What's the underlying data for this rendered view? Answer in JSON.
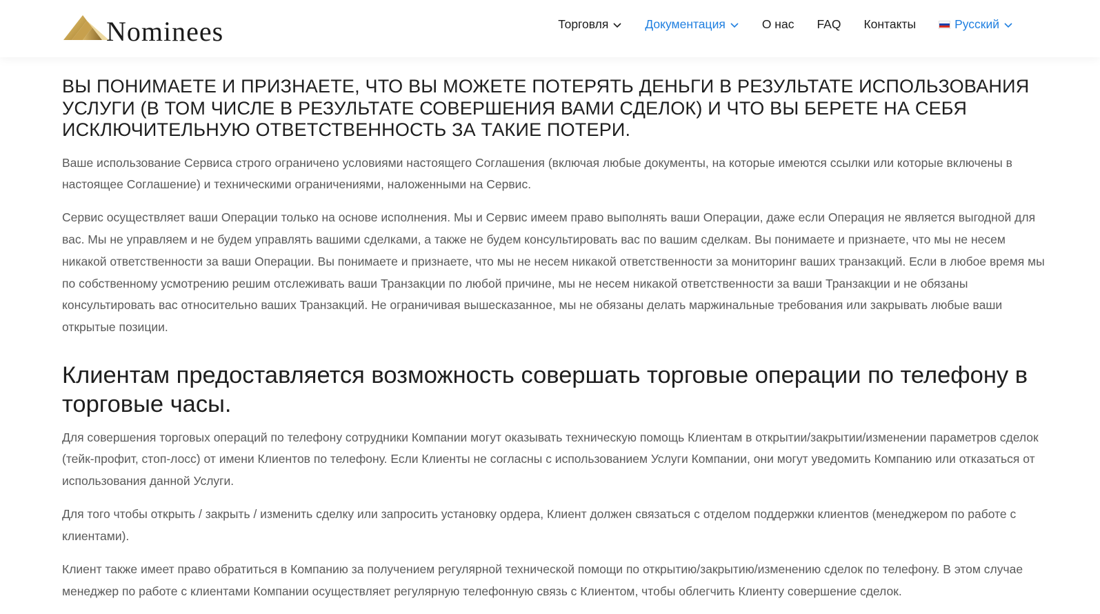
{
  "header": {
    "logo_text": "Nominees",
    "nav": [
      {
        "label": "Торговля",
        "has_dropdown": true,
        "active": false
      },
      {
        "label": "Документация",
        "has_dropdown": true,
        "active": true
      },
      {
        "label": "О нас",
        "has_dropdown": false,
        "active": false
      },
      {
        "label": "FAQ",
        "has_dropdown": false,
        "active": false
      },
      {
        "label": "Контакты",
        "has_dropdown": false,
        "active": false
      }
    ],
    "language": {
      "label": "Русский",
      "flag_icon": "russia-flag-icon"
    }
  },
  "colors": {
    "accent": "#1f7fe0",
    "text_dark": "#1e1e1e",
    "text_body": "#5a5a5a",
    "logo_gold": "#c9a24a"
  },
  "content": {
    "warning_heading": "ВЫ ПОНИМАЕТЕ И ПРИЗНАЕТЕ, ЧТО ВЫ МОЖЕТЕ ПОТЕРЯТЬ ДЕНЬГИ В РЕЗУЛЬТАТЕ ИСПОЛЬЗОВАНИЯ УСЛУГИ (В ТОМ ЧИСЛЕ В РЕЗУЛЬТАТЕ СОВЕРШЕНИЯ ВАМИ СДЕЛОК) И ЧТО ВЫ БЕРЕТЕ НА СЕБЯ ИСКЛЮЧИТЕЛЬНУЮ ОТВЕТСТВЕННОСТЬ ЗА ТАКИЕ ПОТЕРИ.",
    "para1": "Ваше использование Сервиса строго ограничено условиями настоящего Соглашения (включая любые документы, на которые имеются ссылки или которые включены в настоящее Соглашение) и техническими ограничениями, наложенными на Сервис.",
    "para2": "Сервис осуществляет ваши Операции только на основе исполнения. Мы и Сервис имеем право выполнять ваши Операции, даже если Операция не является выгодной для вас. Мы не управляем и не будем управлять вашими сделками, а также не будем консультировать вас по вашим сделкам. Вы понимаете и признаете, что мы не несем никакой ответственности за ваши Операции. Вы понимаете и признаете, что мы не несем никакой ответственности за мониторинг ваших транзакций. Если в любое время мы по собственному усмотрению решим отслеживать ваши Транзакции по любой причине, мы не несем никакой ответственности за ваши Транзакции и не обязаны консультировать вас относительно ваших Транзакций. Не ограничивая вышесказанное, мы не обязаны делать маржинальные требования или закрывать любые ваши открытые позиции.",
    "section_heading": "Клиентам предоставляется возможность совершать торговые операции по телефону в торговые часы.",
    "para3": "Для совершения торговых операций по телефону сотрудники Компании могут оказывать техническую помощь Клиентам в открытии/закрытии/изменении параметров сделок (тейк-профит, стоп-лосс) от имени Клиентов по телефону. Если Клиенты не согласны с использованием Услуги Компании, они могут уведомить Компанию или отказаться от использования данной Услуги.",
    "para4": "Для того чтобы открыть / закрыть / изменить сделку или запросить установку ордера, Клиент должен связаться с отделом поддержки клиентов (менеджером по работе с клиентами).",
    "para5": "Клиент также имеет право обратиться в Компанию за получением регулярной технической помощи по открытию/закрытию/изменению сделок по телефону. В этом случае менеджер по работе с клиентами Компании осуществляет регулярную телефонную связь с Клиентом, чтобы облегчить Клиенту совершение сделок."
  }
}
